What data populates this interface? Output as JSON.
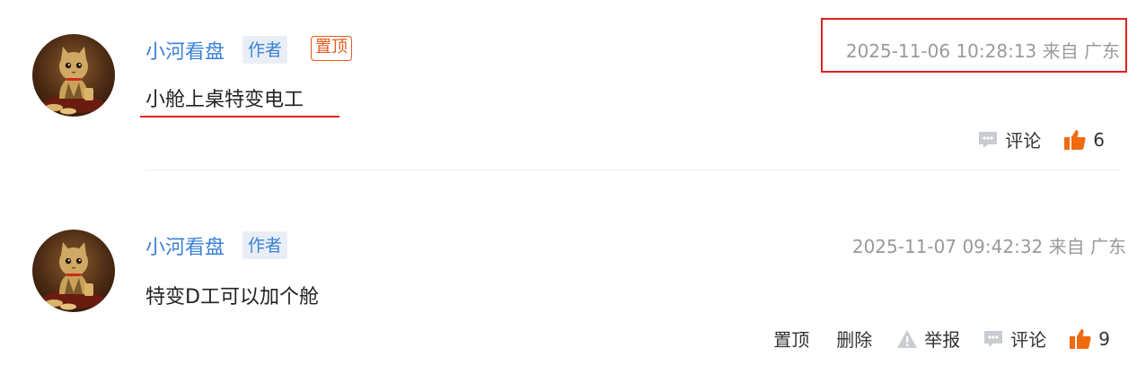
{
  "comments": [
    {
      "username": "小河看盘",
      "author_badge": "作者",
      "pinned_badge": "置顶",
      "timestamp": "2025-11-06 10:28:13 来自 广东",
      "content": "小舱上桌特变电工",
      "comment_label": "评论",
      "like_count": "6"
    },
    {
      "username": "小河看盘",
      "author_badge": "作者",
      "timestamp": "2025-11-07 09:42:32 来自 广东",
      "content": "特变D工可以加个舱",
      "pin_label": "置顶",
      "delete_label": "删除",
      "report_label": "举报",
      "comment_label": "评论",
      "like_count": "9"
    }
  ],
  "colors": {
    "username": "#3b82d6",
    "pinned": "#e45a1d",
    "like": "#f06a0f",
    "annotation": "#e02020"
  },
  "icons": {
    "comment": "speech-bubble-icon",
    "like": "thumbs-up-icon",
    "report": "warning-triangle-icon"
  }
}
